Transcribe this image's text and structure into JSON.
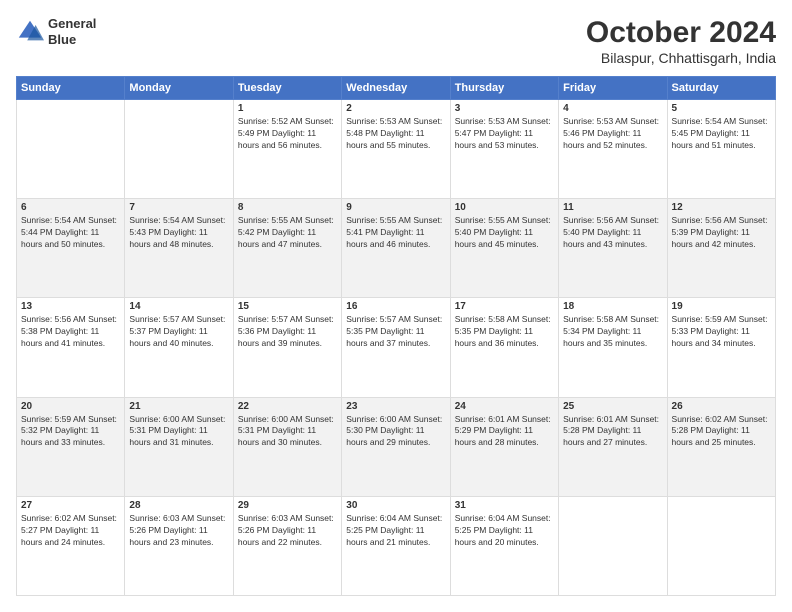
{
  "header": {
    "logo_line1": "General",
    "logo_line2": "Blue",
    "title": "October 2024",
    "subtitle": "Bilaspur, Chhattisgarh, India"
  },
  "days_of_week": [
    "Sunday",
    "Monday",
    "Tuesday",
    "Wednesday",
    "Thursday",
    "Friday",
    "Saturday"
  ],
  "weeks": [
    [
      {
        "day": "",
        "info": ""
      },
      {
        "day": "",
        "info": ""
      },
      {
        "day": "1",
        "info": "Sunrise: 5:52 AM\nSunset: 5:49 PM\nDaylight: 11 hours\nand 56 minutes."
      },
      {
        "day": "2",
        "info": "Sunrise: 5:53 AM\nSunset: 5:48 PM\nDaylight: 11 hours\nand 55 minutes."
      },
      {
        "day": "3",
        "info": "Sunrise: 5:53 AM\nSunset: 5:47 PM\nDaylight: 11 hours\nand 53 minutes."
      },
      {
        "day": "4",
        "info": "Sunrise: 5:53 AM\nSunset: 5:46 PM\nDaylight: 11 hours\nand 52 minutes."
      },
      {
        "day": "5",
        "info": "Sunrise: 5:54 AM\nSunset: 5:45 PM\nDaylight: 11 hours\nand 51 minutes."
      }
    ],
    [
      {
        "day": "6",
        "info": "Sunrise: 5:54 AM\nSunset: 5:44 PM\nDaylight: 11 hours\nand 50 minutes."
      },
      {
        "day": "7",
        "info": "Sunrise: 5:54 AM\nSunset: 5:43 PM\nDaylight: 11 hours\nand 48 minutes."
      },
      {
        "day": "8",
        "info": "Sunrise: 5:55 AM\nSunset: 5:42 PM\nDaylight: 11 hours\nand 47 minutes."
      },
      {
        "day": "9",
        "info": "Sunrise: 5:55 AM\nSunset: 5:41 PM\nDaylight: 11 hours\nand 46 minutes."
      },
      {
        "day": "10",
        "info": "Sunrise: 5:55 AM\nSunset: 5:40 PM\nDaylight: 11 hours\nand 45 minutes."
      },
      {
        "day": "11",
        "info": "Sunrise: 5:56 AM\nSunset: 5:40 PM\nDaylight: 11 hours\nand 43 minutes."
      },
      {
        "day": "12",
        "info": "Sunrise: 5:56 AM\nSunset: 5:39 PM\nDaylight: 11 hours\nand 42 minutes."
      }
    ],
    [
      {
        "day": "13",
        "info": "Sunrise: 5:56 AM\nSunset: 5:38 PM\nDaylight: 11 hours\nand 41 minutes."
      },
      {
        "day": "14",
        "info": "Sunrise: 5:57 AM\nSunset: 5:37 PM\nDaylight: 11 hours\nand 40 minutes."
      },
      {
        "day": "15",
        "info": "Sunrise: 5:57 AM\nSunset: 5:36 PM\nDaylight: 11 hours\nand 39 minutes."
      },
      {
        "day": "16",
        "info": "Sunrise: 5:57 AM\nSunset: 5:35 PM\nDaylight: 11 hours\nand 37 minutes."
      },
      {
        "day": "17",
        "info": "Sunrise: 5:58 AM\nSunset: 5:35 PM\nDaylight: 11 hours\nand 36 minutes."
      },
      {
        "day": "18",
        "info": "Sunrise: 5:58 AM\nSunset: 5:34 PM\nDaylight: 11 hours\nand 35 minutes."
      },
      {
        "day": "19",
        "info": "Sunrise: 5:59 AM\nSunset: 5:33 PM\nDaylight: 11 hours\nand 34 minutes."
      }
    ],
    [
      {
        "day": "20",
        "info": "Sunrise: 5:59 AM\nSunset: 5:32 PM\nDaylight: 11 hours\nand 33 minutes."
      },
      {
        "day": "21",
        "info": "Sunrise: 6:00 AM\nSunset: 5:31 PM\nDaylight: 11 hours\nand 31 minutes."
      },
      {
        "day": "22",
        "info": "Sunrise: 6:00 AM\nSunset: 5:31 PM\nDaylight: 11 hours\nand 30 minutes."
      },
      {
        "day": "23",
        "info": "Sunrise: 6:00 AM\nSunset: 5:30 PM\nDaylight: 11 hours\nand 29 minutes."
      },
      {
        "day": "24",
        "info": "Sunrise: 6:01 AM\nSunset: 5:29 PM\nDaylight: 11 hours\nand 28 minutes."
      },
      {
        "day": "25",
        "info": "Sunrise: 6:01 AM\nSunset: 5:28 PM\nDaylight: 11 hours\nand 27 minutes."
      },
      {
        "day": "26",
        "info": "Sunrise: 6:02 AM\nSunset: 5:28 PM\nDaylight: 11 hours\nand 25 minutes."
      }
    ],
    [
      {
        "day": "27",
        "info": "Sunrise: 6:02 AM\nSunset: 5:27 PM\nDaylight: 11 hours\nand 24 minutes."
      },
      {
        "day": "28",
        "info": "Sunrise: 6:03 AM\nSunset: 5:26 PM\nDaylight: 11 hours\nand 23 minutes."
      },
      {
        "day": "29",
        "info": "Sunrise: 6:03 AM\nSunset: 5:26 PM\nDaylight: 11 hours\nand 22 minutes."
      },
      {
        "day": "30",
        "info": "Sunrise: 6:04 AM\nSunset: 5:25 PM\nDaylight: 11 hours\nand 21 minutes."
      },
      {
        "day": "31",
        "info": "Sunrise: 6:04 AM\nSunset: 5:25 PM\nDaylight: 11 hours\nand 20 minutes."
      },
      {
        "day": "",
        "info": ""
      },
      {
        "day": "",
        "info": ""
      }
    ]
  ]
}
